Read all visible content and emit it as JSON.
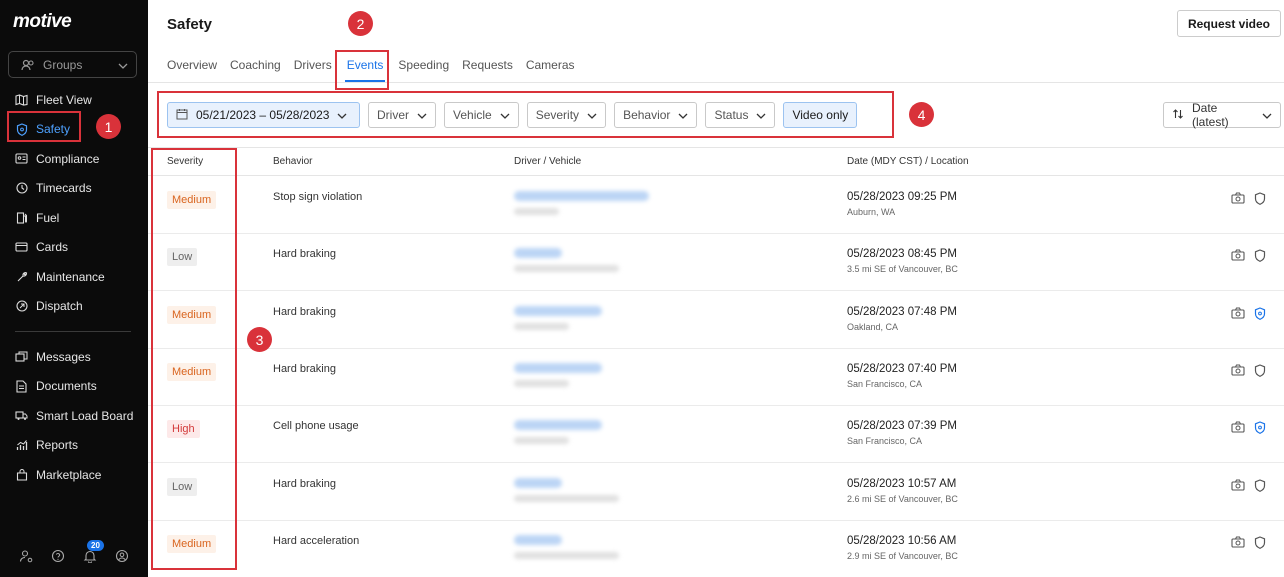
{
  "sidebar": {
    "logo": "motive",
    "groups_label": "Groups",
    "items": [
      {
        "label": "Fleet View",
        "icon": "map-icon",
        "active": false
      },
      {
        "label": "Safety",
        "icon": "shield-icon",
        "active": true
      },
      {
        "label": "Compliance",
        "icon": "id-card-icon",
        "active": false
      },
      {
        "label": "Timecards",
        "icon": "clock-icon",
        "active": false
      },
      {
        "label": "Fuel",
        "icon": "fuel-icon",
        "active": false
      },
      {
        "label": "Cards",
        "icon": "credit-card-icon",
        "active": false
      },
      {
        "label": "Maintenance",
        "icon": "wrench-icon",
        "active": false
      },
      {
        "label": "Dispatch",
        "icon": "dispatch-icon",
        "active": false
      }
    ],
    "items2": [
      {
        "label": "Messages",
        "icon": "messages-icon"
      },
      {
        "label": "Documents",
        "icon": "document-icon"
      },
      {
        "label": "Smart Load Board",
        "icon": "truck-icon"
      },
      {
        "label": "Reports",
        "icon": "chart-icon"
      },
      {
        "label": "Marketplace",
        "icon": "bag-icon"
      }
    ],
    "notification_count": "20"
  },
  "header": {
    "title": "Safety",
    "request_video": "Request video"
  },
  "tabs": [
    "Overview",
    "Coaching",
    "Drivers",
    "Events",
    "Speeding",
    "Requests",
    "Cameras"
  ],
  "active_tab": "Events",
  "filters": {
    "date_range": "05/21/2023 – 05/28/2023",
    "driver": "Driver",
    "vehicle": "Vehicle",
    "severity": "Severity",
    "behavior": "Behavior",
    "status": "Status",
    "video_only": "Video only",
    "sort": "Date (latest)"
  },
  "table": {
    "headers": {
      "severity": "Severity",
      "behavior": "Behavior",
      "driver_vehicle": "Driver / Vehicle",
      "date_location": "Date (MDY CST) / Location"
    },
    "rows": [
      {
        "severity": "Medium",
        "level": "medium",
        "behavior": "Stop sign violation",
        "date": "05/28/2023 09:25 PM",
        "location": "Auburn, WA",
        "shield_active": false
      },
      {
        "severity": "Low",
        "level": "low",
        "behavior": "Hard braking",
        "date": "05/28/2023 08:45 PM",
        "location": "3.5 mi SE of Vancouver, BC",
        "shield_active": false
      },
      {
        "severity": "Medium",
        "level": "medium",
        "behavior": "Hard braking",
        "date": "05/28/2023 07:48 PM",
        "location": "Oakland, CA",
        "shield_active": true
      },
      {
        "severity": "Medium",
        "level": "medium",
        "behavior": "Hard braking",
        "date": "05/28/2023 07:40 PM",
        "location": "San Francisco, CA",
        "shield_active": false
      },
      {
        "severity": "High",
        "level": "high",
        "behavior": "Cell phone usage",
        "date": "05/28/2023 07:39 PM",
        "location": "San Francisco, CA",
        "shield_active": true
      },
      {
        "severity": "Low",
        "level": "low",
        "behavior": "Hard braking",
        "date": "05/28/2023 10:57 AM",
        "location": "2.6 mi SE of Vancouver, BC",
        "shield_active": false
      },
      {
        "severity": "Medium",
        "level": "medium",
        "behavior": "Hard acceleration",
        "date": "05/28/2023 10:56 AM",
        "location": "2.9 mi SE of Vancouver, BC",
        "shield_active": false
      }
    ]
  },
  "annotations": [
    "1",
    "2",
    "3",
    "4"
  ],
  "colors": {
    "accent": "#1a73e8",
    "annotation": "#d9323a",
    "sidebar_bg": "#0b0b0b"
  }
}
